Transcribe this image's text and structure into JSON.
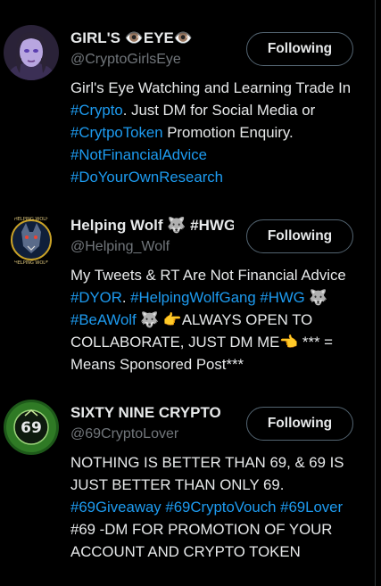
{
  "accounts": [
    {
      "name": "GIRL'S 👁️EYE👁️",
      "handle": "@CryptoGirlsEye",
      "button": "Following",
      "bio": [
        {
          "t": "Girl's Eye Watching and Learning Trade In "
        },
        {
          "t": "#Crypto",
          "tag": true
        },
        {
          "t": ". Just DM for Social Media or "
        },
        {
          "t": "#CrytpoToken",
          "tag": true
        },
        {
          "t": " Promotion Enquiry. "
        },
        {
          "t": "#NotFinancialAdvice",
          "tag": true
        },
        {
          "t": " "
        },
        {
          "t": "#DoYourOwnResearch",
          "tag": true
        }
      ]
    },
    {
      "name": "Helping Wolf 🐺 #HWG",
      "handle": "@Helping_Wolf",
      "button": "Following",
      "avatar_text": "HELPING WOLF",
      "bio": [
        {
          "t": "My Tweets & RT Are Not Financial Advice "
        },
        {
          "t": "#DYOR",
          "tag": true
        },
        {
          "t": ". "
        },
        {
          "t": "#HelpingWolfGang",
          "tag": true
        },
        {
          "t": " "
        },
        {
          "t": "#HWG",
          "tag": true
        },
        {
          "t": " 🐺 "
        },
        {
          "t": "#BeAWolf",
          "tag": true
        },
        {
          "t": " 🐺 👉ALWAYS OPEN TO COLLABORATE, JUST DM ME👈 *** = Means Sponsored Post***"
        }
      ]
    },
    {
      "name": "SIXTY NINE CRYPTO",
      "handle": "@69CryptoLover",
      "button": "Following",
      "avatar_text": "69",
      "bio": [
        {
          "t": "NOTHING IS BETTER THAN 69, & 69 IS JUST BETTER THAN ONLY 69. "
        },
        {
          "t": "#69Giveaway",
          "tag": true
        },
        {
          "t": " "
        },
        {
          "t": "#69CryptoVouch",
          "tag": true
        },
        {
          "t": " "
        },
        {
          "t": "#69Lover",
          "tag": true
        },
        {
          "t": " #69 -DM FOR PROMOTION OF YOUR ACCOUNT AND CRYPTO TOKEN"
        }
      ]
    }
  ],
  "colors": {
    "accent": "#1d9bf0",
    "text": "#e7e9ea",
    "muted": "#71767b",
    "background": "#000000"
  }
}
